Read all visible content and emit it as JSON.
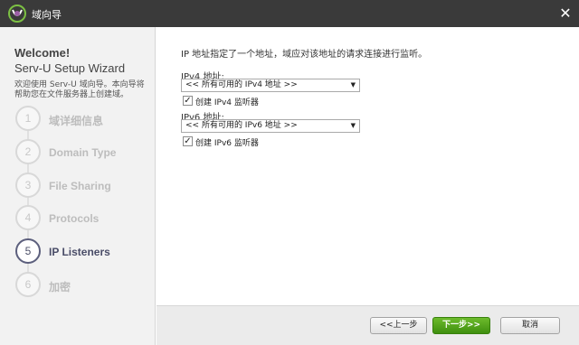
{
  "window": {
    "title": "域向导",
    "close_glyph": "✕"
  },
  "sidebar": {
    "welcome": "Welcome!",
    "wizard_title": "Serv-U Setup Wizard",
    "intro_line1": "欢迎使用 Serv-U 域向导。本向导将",
    "intro_line2": "帮助您在文件服务器上创建域。",
    "steps": [
      {
        "number": "1",
        "label": "域详细信息"
      },
      {
        "number": "2",
        "label": "Domain Type"
      },
      {
        "number": "3",
        "label": "File Sharing"
      },
      {
        "number": "4",
        "label": "Protocols"
      },
      {
        "number": "5",
        "label": "IP Listeners"
      },
      {
        "number": "6",
        "label": "加密"
      }
    ],
    "active_step": "5"
  },
  "main": {
    "description": "IP 地址指定了一个地址，域应对该地址的请求连接进行监听。",
    "ipv4": {
      "label": "IPv4 地址:",
      "selected": "<< 所有可用的 IPv4 地址 >>",
      "checkbox_label": "创建 IPv4 监听器",
      "checked": true
    },
    "ipv6": {
      "label": "IPv6 地址:",
      "selected": "<< 所有可用的 IPv6 地址 >>",
      "checkbox_label": "创建 IPv6 监听器",
      "checked": true
    },
    "dropdown_arrow": "▼",
    "check_glyph": "✓"
  },
  "footer": {
    "back_label": "<<上一步",
    "next_label": "下一步>>",
    "cancel_label": "取消"
  },
  "colors": {
    "titlebar": "#3a3a3a",
    "sidebar_bg": "#f2f2f2",
    "active_step": "#4a4d68",
    "inactive_step": "#bdbdbd",
    "next_button": "#4fa31b"
  },
  "icons": {
    "app_logo": "serv-u-logo-icon",
    "close": "close-icon",
    "dropdown": "chevron-down-icon",
    "check": "checkmark-icon"
  }
}
